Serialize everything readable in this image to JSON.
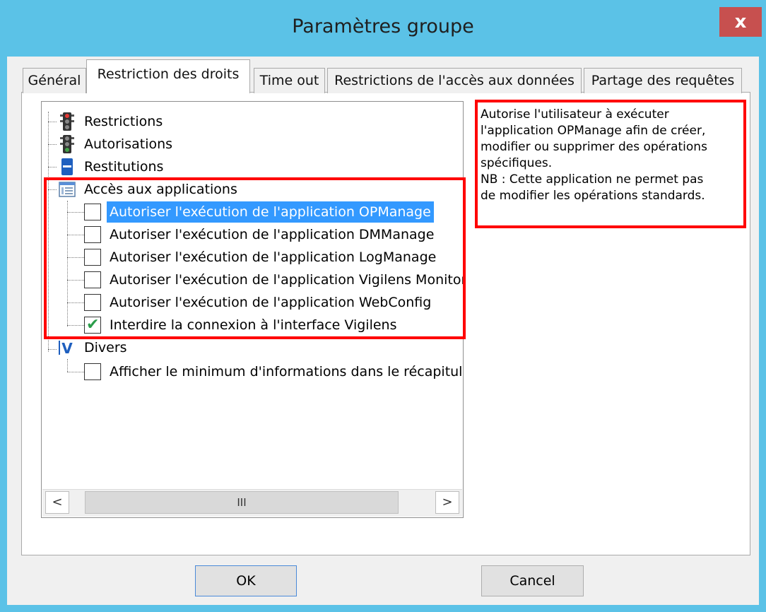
{
  "window": {
    "title": "Paramètres groupe",
    "close_label": "x"
  },
  "tabs": [
    {
      "label": "Général",
      "active": false
    },
    {
      "label": "Restriction des droits",
      "active": true
    },
    {
      "label": "Time out",
      "active": false
    },
    {
      "label": "Restrictions de l'accès aux données",
      "active": false
    },
    {
      "label": "Partage des requêtes",
      "active": false
    }
  ],
  "tree": {
    "nodes": [
      {
        "label": "Restrictions",
        "icon": "traffic-light-red-icon"
      },
      {
        "label": "Autorisations",
        "icon": "traffic-light-green-icon"
      },
      {
        "label": "Restitutions",
        "icon": "device-blue-icon"
      },
      {
        "label": "Accès aux applications",
        "icon": "window-list-icon"
      }
    ],
    "app_items": [
      {
        "label": "Autoriser l'exécution de l'application OPManage",
        "checked": false,
        "selected": true
      },
      {
        "label": "Autoriser l'exécution de l'application DMManage",
        "checked": false,
        "selected": false
      },
      {
        "label": "Autoriser l'exécution de l'application LogManage",
        "checked": false,
        "selected": false
      },
      {
        "label": "Autoriser l'exécution de l'application Vigilens Monitor",
        "checked": false,
        "selected": false
      },
      {
        "label": "Autoriser l'exécution de l'application WebConfig",
        "checked": false,
        "selected": false
      },
      {
        "label": "Interdire la connexion à l'interface Vigilens",
        "checked": true,
        "selected": false
      }
    ],
    "misc_node": {
      "label": "Divers",
      "icon": "v-logo-icon"
    },
    "misc_items": [
      {
        "label": "Afficher le minimum d'informations dans le récapitula",
        "checked": false
      }
    ],
    "scrollbar": {
      "left_arrow": "<",
      "right_arrow": ">",
      "thumb_grip": "III"
    }
  },
  "description": {
    "lines": [
      "Autorise l'utilisateur à exécuter",
      "l'application OPManage afin de créer,",
      "modifier ou supprimer des opérations",
      "spécifiques.",
      "NB : Cette application ne permet pas",
      "de modifier les opérations standards."
    ]
  },
  "buttons": {
    "ok": "OK",
    "cancel": "Cancel"
  },
  "colors": {
    "titlebar": "#5bc2e7",
    "close": "#c7504f",
    "highlight": "#ff0000",
    "selection": "#3399ff",
    "check": "#2a9d4a"
  }
}
